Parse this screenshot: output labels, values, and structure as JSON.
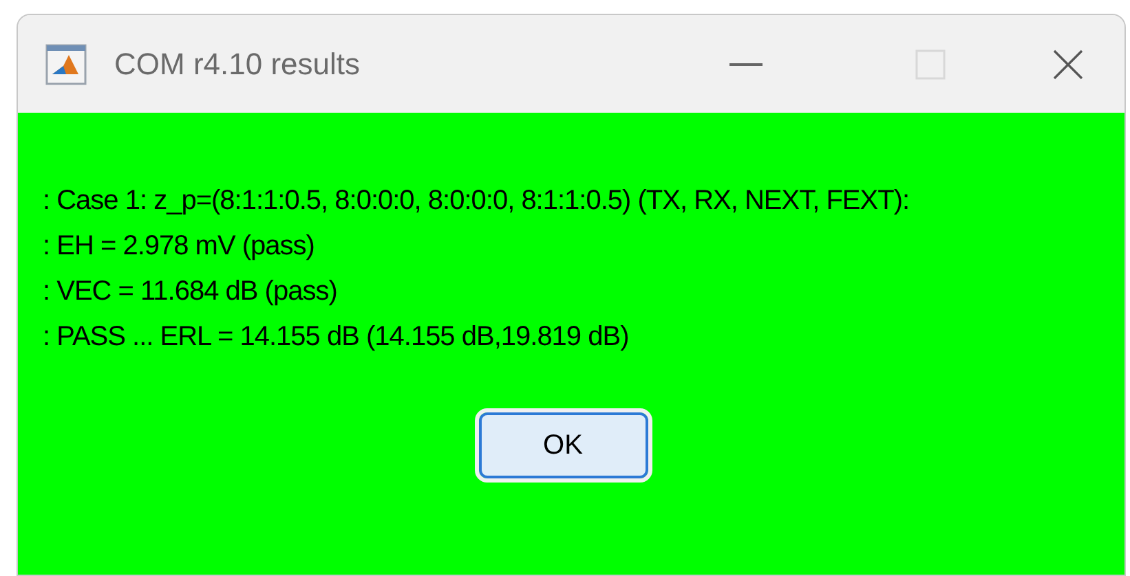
{
  "window": {
    "title": "COM r4.10 results",
    "maximize_disabled": true
  },
  "message_lines": [
    ": Case 1: z_p=(8:1:1:0.5, 8:0:0:0, 8:0:0:0, 8:1:1:0.5) (TX, RX, NEXT, FEXT):",
    ": EH = 2.978 mV (pass)",
    ": VEC = 11.684 dB (pass)",
    ": PASS ... ERL = 14.155 dB (14.155 dB,19.819 dB)"
  ],
  "buttons": [
    "OK"
  ]
}
